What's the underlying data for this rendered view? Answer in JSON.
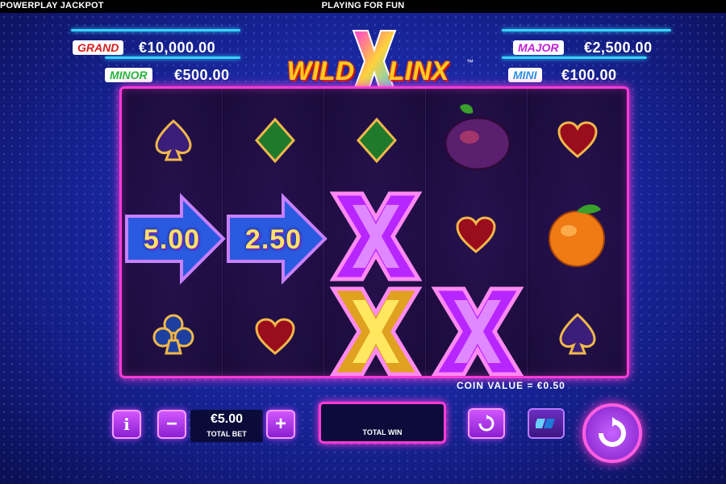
{
  "header": {
    "left_title": "POWERPLAY JACKPOT",
    "center_title": "PLAYING FOR FUN"
  },
  "logo": {
    "word1": "WILD",
    "letter": "X",
    "word2": "LINX",
    "tm": "™"
  },
  "jackpots": {
    "grand": {
      "label": "GRAND",
      "amount": "€10,000.00",
      "color": "#d81f1f"
    },
    "minor": {
      "label": "MINOR",
      "amount": "€500.00",
      "color": "#28b43c"
    },
    "major": {
      "label": "MAJOR",
      "amount": "€2,500.00",
      "color": "#c21fd8"
    },
    "mini": {
      "label": "MINI",
      "amount": "€100.00",
      "color": "#2c8ee0"
    }
  },
  "reels": {
    "arrows": [
      "5.00",
      "2.50"
    ],
    "symbols": [
      [
        "spade",
        "arrow",
        "club"
      ],
      [
        "diamond",
        "arrow",
        "heart"
      ],
      [
        "diamond",
        "wild-x",
        "wild-x-gold"
      ],
      [
        "plum",
        "heart",
        "wild-x"
      ],
      [
        "heart",
        "orange",
        "spade"
      ]
    ]
  },
  "coin_value": "COIN VALUE = €0.50",
  "controls": {
    "info_label": "i",
    "minus_label": "−",
    "plus_label": "+",
    "total_bet_value": "€5.00",
    "total_bet_label": "TOTAL BET",
    "total_win_label": "TOTAL WIN"
  },
  "icons": [
    "info-icon",
    "minus-icon",
    "plus-icon",
    "autoplay-icon",
    "turbo-icon",
    "spin-icon"
  ]
}
